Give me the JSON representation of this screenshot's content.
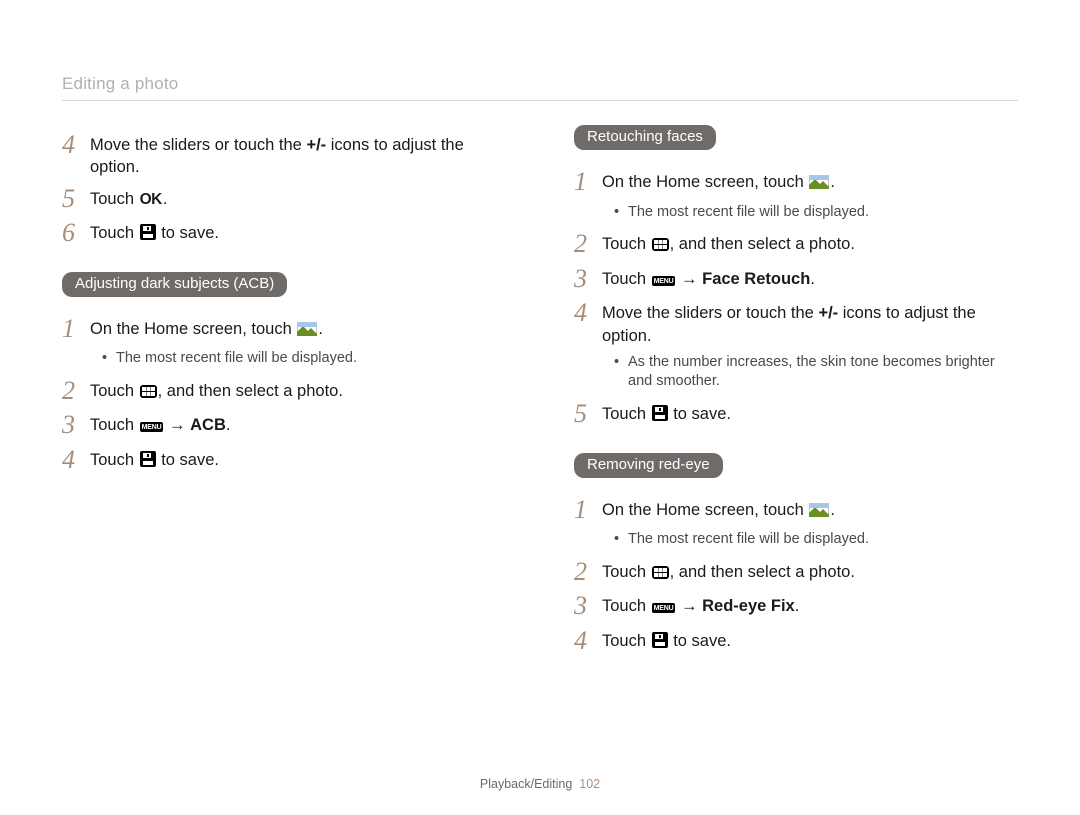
{
  "header": "Editing a photo",
  "footer_section": "Playback/Editing",
  "footer_page": "102",
  "shared": {
    "touch": "Touch ",
    "on_home": "On the Home screen, touch ",
    "recent_note": "The most recent file will be displayed.",
    "select_photo": ", and then select a photo.",
    "to_save": " to save.",
    "arrow": " → ",
    "period": "."
  },
  "bold_words": {
    "plusminus": "+/-",
    "acb": "ACB",
    "face_retouch": "Face Retouch",
    "redeye": "Red-eye Fix"
  },
  "icon_labels": {
    "ok": "OK",
    "menu": "MENU"
  },
  "left": {
    "s4a": "Move the sliders or touch the ",
    "s4b": " icons to adjust the option.",
    "pill_acb": "Adjusting dark subjects (ACB)"
  },
  "right": {
    "pill_retouch": "Retouching faces",
    "skin_note": "As the number increases, the skin tone becomes brighter and smoother.",
    "pill_redeye": "Removing red-eye"
  }
}
